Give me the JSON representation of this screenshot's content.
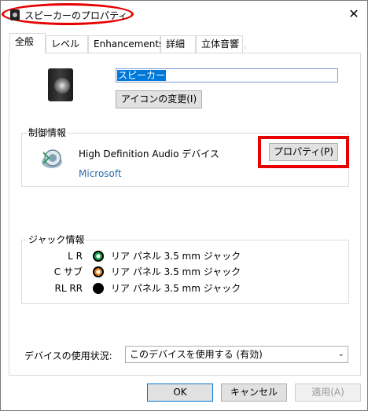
{
  "window": {
    "title": "スピーカーのプロパティ",
    "close_label": "✕"
  },
  "tabs": [
    {
      "label": "全般",
      "active": true
    },
    {
      "label": "レベル"
    },
    {
      "label": "Enhancements"
    },
    {
      "label": "詳細"
    },
    {
      "label": "立体音響"
    }
  ],
  "general": {
    "device_name_value": "スピーカー",
    "change_icon_label": "アイコンの変更(I)"
  },
  "controller": {
    "group_label": "制御情報",
    "device_name": "High Definition Audio デバイス",
    "vendor": "Microsoft",
    "properties_label": "プロパティ(P)"
  },
  "jack": {
    "group_label": "ジャック情報",
    "rows": [
      {
        "label": "L R",
        "color": "#1aa64a",
        "text": "リア パネル 3.5 mm ジャック"
      },
      {
        "label": "C サブ",
        "color": "#e07a1f",
        "text": "リア パネル 3.5 mm ジャック"
      },
      {
        "label": "RL RR",
        "color": "#000000",
        "text": "リア パネル 3.5 mm ジャック"
      }
    ]
  },
  "usage": {
    "label": "デバイスの使用状況:",
    "selected": "このデバイスを使用する (有効)"
  },
  "buttons": {
    "ok": "OK",
    "cancel": "キャンセル",
    "apply": "適用(A)"
  },
  "colors": {
    "annotation_red": "#e60000",
    "accent": "#0078d7"
  }
}
